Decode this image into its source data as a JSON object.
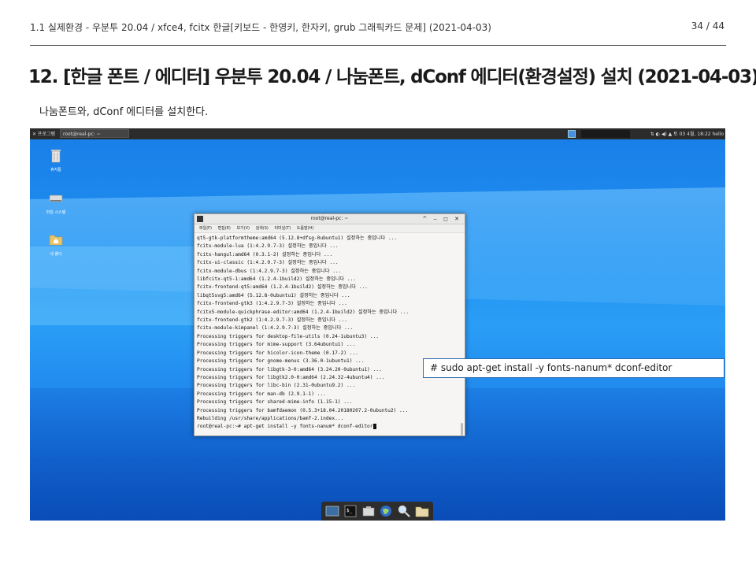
{
  "header": {
    "breadcrumb": "1.1 실제환경 - 우분투 20.04 / xfce4, fcitx 한글[키보드 - 한영키, 한자키, grub 그래픽카드 문제] (2021-04-03)",
    "page_number": "34 / 44"
  },
  "title": "12. [한글 폰트 / 에디터] 우분투 20.04 / 나눔폰트, dConf 에디터(환경설정) 설치 (2021-04-03)",
  "subtitle": "나눔폰트와, dConf 에디터를 설치한다.",
  "desktop": {
    "topbar": {
      "apps_label": "✕ 프로그램",
      "window_label": "root@real-pc: ~",
      "status_text": "⇅ ◐ ◀) ▲  토 03 4월, 18:22  hello"
    },
    "icons": [
      {
        "label": "휴지통"
      },
      {
        "label": "파일 시스템"
      },
      {
        "label": "내 폴더"
      }
    ]
  },
  "terminal": {
    "title": "root@real-pc: ~",
    "controls": "^ ‒ ◻ ✕",
    "menu": [
      "파일(F)",
      "편집(E)",
      "보기(V)",
      "검색(S)",
      "터미널(T)",
      "도움말(H)"
    ],
    "lines": [
      "qt5-gtk-platformtheme:amd64 (5.12.8+dfsg-0ubuntu1) 설정하는 중입니다 ...",
      "fcitx-module-lua (1:4.2.9.7-3) 설정하는 중입니다 ...",
      "fcitx-hangul:amd64 (0.3.1-2) 설정하는 중입니다 ...",
      "fcitx-ui-classic (1:4.2.9.7-3) 설정하는 중입니다 ...",
      "fcitx-module-dbus (1:4.2.9.7-3) 설정하는 중입니다 ...",
      "libfcitx-qt5-1:amd64 (1.2.4-1build2) 설정하는 중입니다 ...",
      "fcitx-frontend-qt5:amd64 (1.2.4-1build2) 설정하는 중입니다 ...",
      "libqt5svg5:amd64 (5.12.8-0ubuntu1) 설정하는 중입니다 ...",
      "fcitx-frontend-gtk3 (1:4.2.9.7-3) 설정하는 중입니다 ...",
      "fcitx5-module-quickphrase-editor:amd64 (1.2.4-1build2) 설정하는 중입니다 ...",
      "fcitx-frontend-gtk2 (1:4.2.9.7-3) 설정하는 중입니다 ...",
      "fcitx-module-kimpanel (1:4.2.9.7-3) 설정하는 중입니다 ...",
      "Processing triggers for desktop-file-utils (0.24-1ubuntu3) ...",
      "Processing triggers for mime-support (3.64ubuntu1) ...",
      "Processing triggers for hicolor-icon-theme (0.17-2) ...",
      "Processing triggers for gnome-menus (3.36.0-1ubuntu1) ...",
      "Processing triggers for libgtk-3-0:amd64 (3.24.20-0ubuntu1) ...",
      "Processing triggers for libgtk2.0-0:amd64 (2.24.32-4ubuntu4) ...",
      "Processing triggers for libc-bin (2.31-0ubuntu9.2) ...",
      "Processing triggers for man-db (2.9.1-1) ...",
      "Processing triggers for shared-mime-info (1.15-1) ...",
      "Processing triggers for bamfdaemon (0.5.3+18.04.20180207.2-0ubuntu2) ...",
      "Rebuilding /usr/share/applications/bamf-2.index...",
      "root@real-pc:~# apt-get install -y fonts-nanum* dconf-editor"
    ]
  },
  "callout": "# sudo apt-get install -y fonts-nanum* dconf-editor"
}
